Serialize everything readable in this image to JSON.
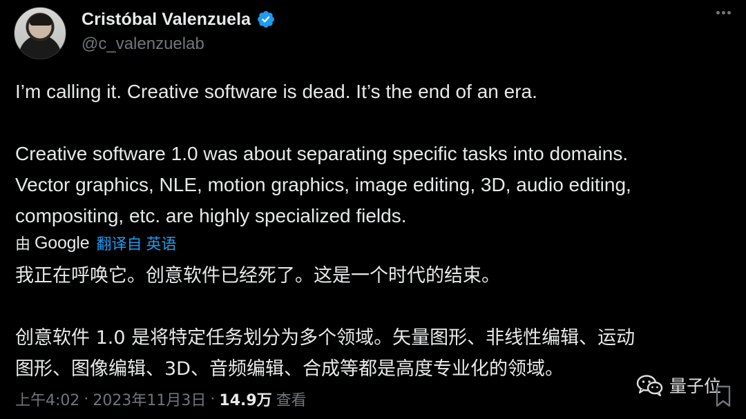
{
  "author": {
    "name": "Cristóbal Valenzuela",
    "handle": "@c_valenzuelab",
    "verified": true
  },
  "tweet": {
    "line1": "I’m calling it. Creative software is dead. It’s the end of an era.",
    "line2": "Creative software 1.0 was about separating specific tasks into domains.",
    "line3": "Vector graphics, NLE, motion graphics, image editing, 3D, audio editing,",
    "line4": "compositing, etc. are highly specialized fields."
  },
  "translation_bar": {
    "by": "由",
    "provider": "Google",
    "translated_from": "翻译自 英语"
  },
  "translation": {
    "line1": "我正在呼唤它。创意软件已经死了。这是一个时代的结束。",
    "line2": "创意软件 1.0 是将特定任务划分为多个领域。矢量图形、非线性编辑、运动",
    "line3": "图形、图像编辑、3D、音频编辑、合成等都是高度专业化的领域。"
  },
  "meta": {
    "time": "上午4:02",
    "separator": "·",
    "date": "2023年11月3日",
    "views_count": "14.9万",
    "views_label": "查看"
  },
  "watermark": {
    "text": "量子位"
  },
  "colors": {
    "background": "#000000",
    "text": "#e7e9ea",
    "muted": "#71767b",
    "accent": "#1d9bf0"
  },
  "icons": [
    "verified-badge-icon",
    "more-icon",
    "bookmark-icon",
    "wechat-icon"
  ]
}
